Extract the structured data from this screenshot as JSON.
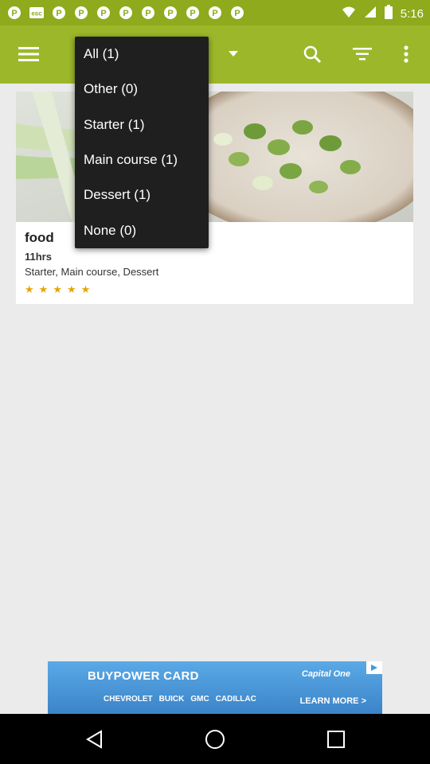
{
  "status_bar": {
    "time": "5:16",
    "left_icons": [
      "pinterest-icon",
      "esc-icon",
      "pinterest-icon",
      "pinterest-icon",
      "pinterest-icon",
      "pinterest-icon",
      "pinterest-icon",
      "pinterest-icon",
      "pinterest-icon",
      "pinterest-icon"
    ]
  },
  "menu": {
    "items": [
      {
        "label": "All (1)"
      },
      {
        "label": "Other (0)"
      },
      {
        "label": "Starter (1)"
      },
      {
        "label": "Main course (1)"
      },
      {
        "label": "Dessert (1)"
      },
      {
        "label": "None (0)"
      }
    ]
  },
  "card": {
    "title": "food",
    "time": "11hrs",
    "categories": "Starter, Main course, Dessert",
    "rating": 5
  },
  "ad": {
    "title": "BUYPOWER CARD",
    "sponsor": "Capital One",
    "brands": [
      "CHEVROLET",
      "BUICK",
      "GMC",
      "CADILLAC"
    ],
    "cta": "LEARN MORE >"
  },
  "colors": {
    "app_bar": "#9cb82a",
    "status_bar": "#8faa1c",
    "menu_bg": "#1f1f1f",
    "star": "#e8a400"
  }
}
